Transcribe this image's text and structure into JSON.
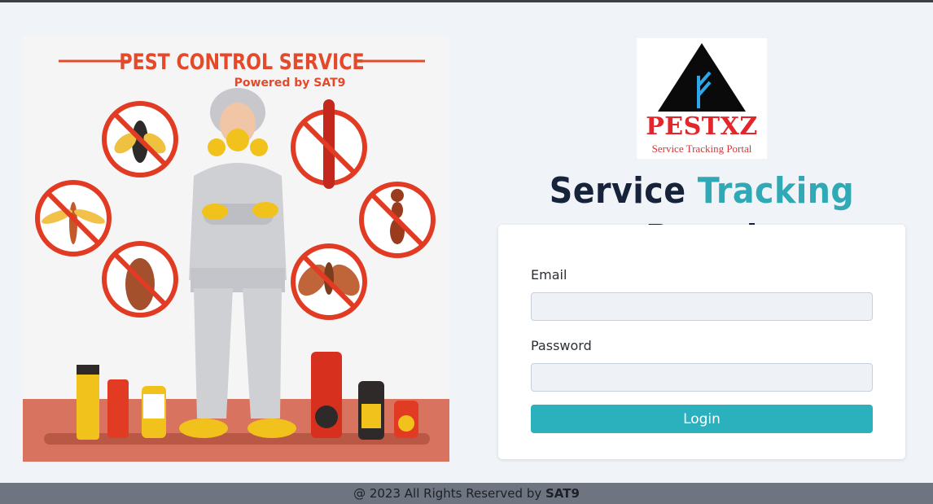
{
  "illustration": {
    "title": "PEST CONTROL SERVICE",
    "subtitle": "Powered by SAT9"
  },
  "logo": {
    "name": "PESTXZ",
    "tagline": "Service Tracking Portal"
  },
  "heading": {
    "part1": "Service ",
    "part2": "Tracking",
    "part3": " Portal",
    "accent_color": "#2fa9b6",
    "dark_color": "#16233a"
  },
  "login_form": {
    "email_label": "Email",
    "email_value": "",
    "password_label": "Password",
    "password_value": "",
    "login_label": "Login",
    "button_color": "#2bb1bd"
  },
  "footer": {
    "prefix": "@ 2023 All Rights Reserved by ",
    "brand": "SAT9"
  }
}
